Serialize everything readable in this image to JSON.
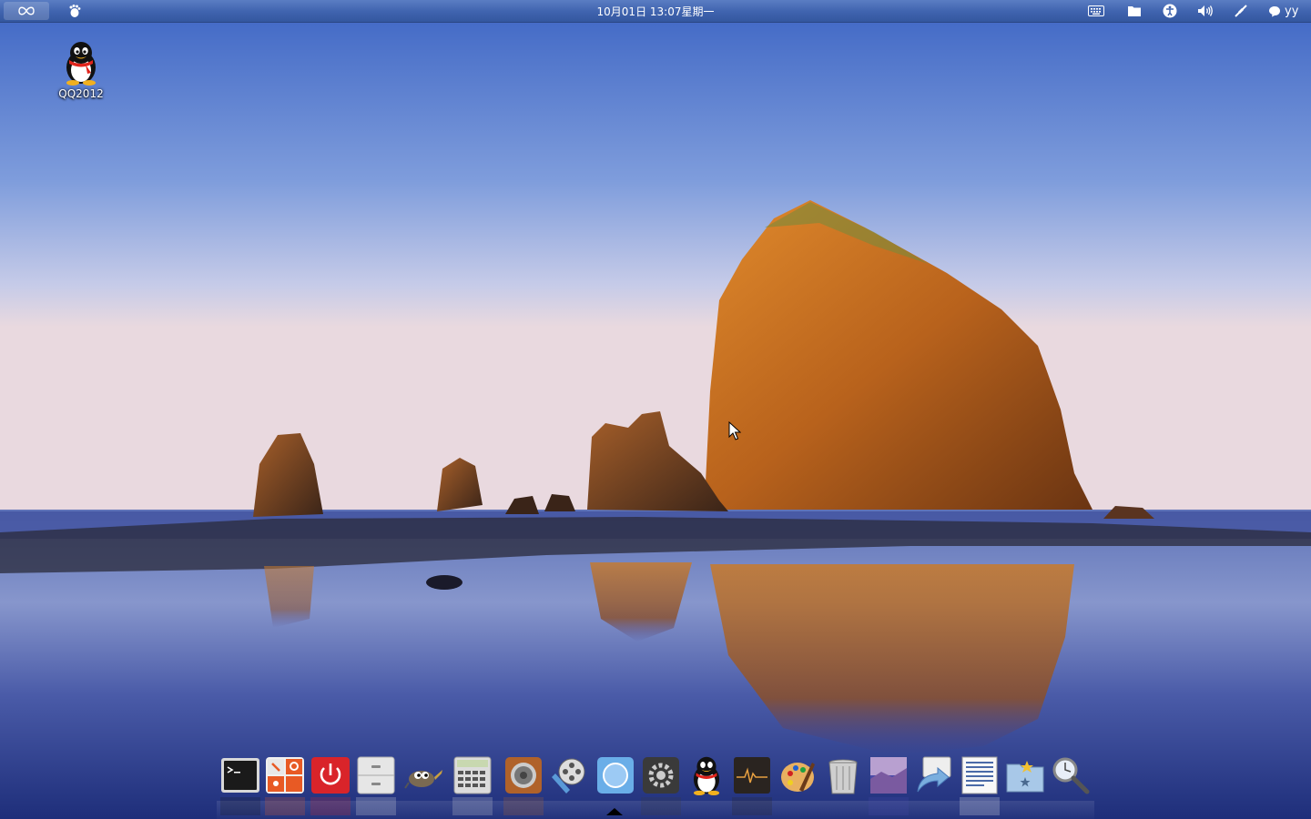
{
  "top_panel": {
    "clock": "10月01日 13:07星期一",
    "user": "yy"
  },
  "desktop": {
    "icons": [
      {
        "label": "QQ2012"
      }
    ]
  },
  "dock": {
    "items": [
      "terminal-icon",
      "system-settings-icon",
      "power-icon",
      "file-manager-icon",
      "gimp-icon",
      "calculator-icon",
      "music-player-icon",
      "video-player-icon",
      "browser-icon",
      "preferences-icon",
      "qq-icon",
      "system-monitor-icon",
      "paint-icon",
      "trash-icon",
      "image-viewer-icon",
      "file-transfer-icon",
      "document-viewer-icon",
      "bookmark-folder-icon",
      "search-icon"
    ]
  }
}
